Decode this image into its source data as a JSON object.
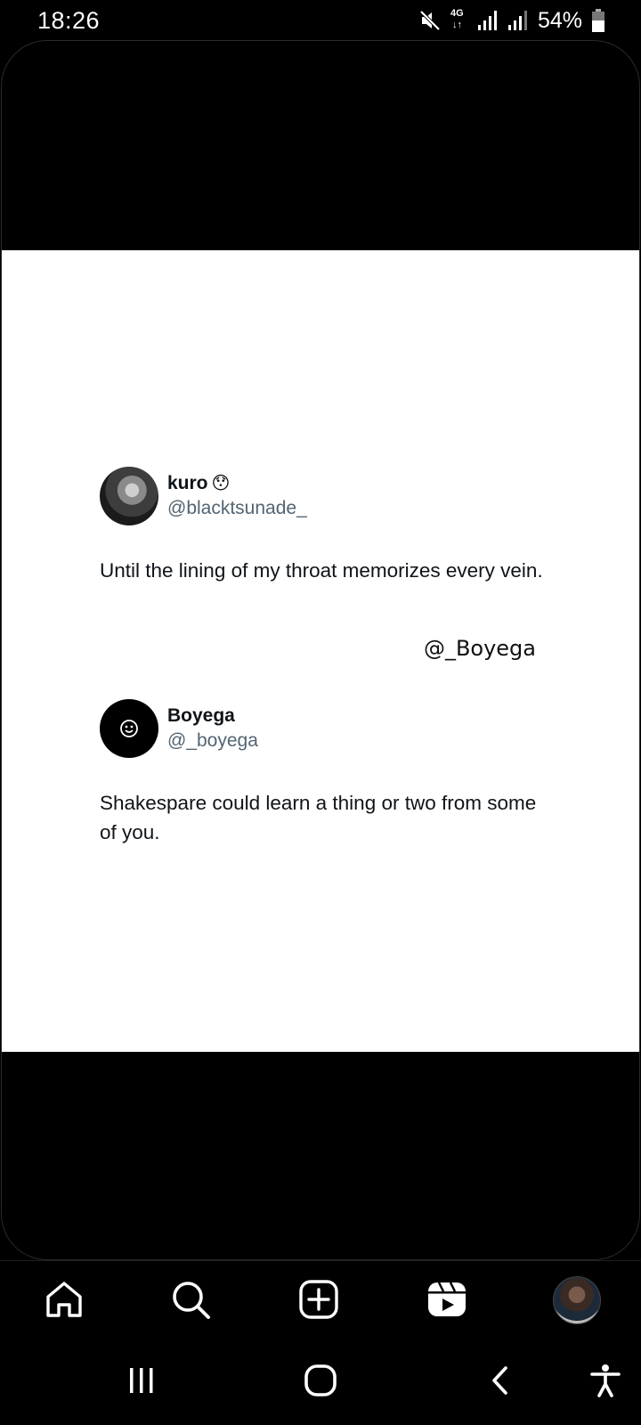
{
  "status_bar": {
    "time": "18:26",
    "network": "4G",
    "battery": "54%",
    "icons": [
      "mute-icon",
      "network-4g-icon",
      "signal-icon",
      "signal-icon",
      "battery-icon"
    ]
  },
  "post": {
    "tweet1": {
      "display_name": "kuro",
      "emoji": "😯",
      "handle": "@blacktsunade_",
      "text": "Until the lining of my throat memorizes every vein."
    },
    "watermark": "@_Boyega",
    "tweet2": {
      "display_name": "Boyega",
      "handle": "@_boyega",
      "text": "Shakespare could learn a thing or two from some of you."
    }
  },
  "bottom_nav": {
    "items": [
      "home-icon",
      "search-icon",
      "create-icon",
      "reels-icon",
      "profile-avatar"
    ]
  },
  "system_nav": {
    "items": [
      "recents-icon",
      "home-icon",
      "back-icon",
      "accessibility-icon"
    ]
  },
  "colors": {
    "background": "#000000",
    "card": "#ffffff",
    "handle": "#536471",
    "text": "#0f1419"
  }
}
